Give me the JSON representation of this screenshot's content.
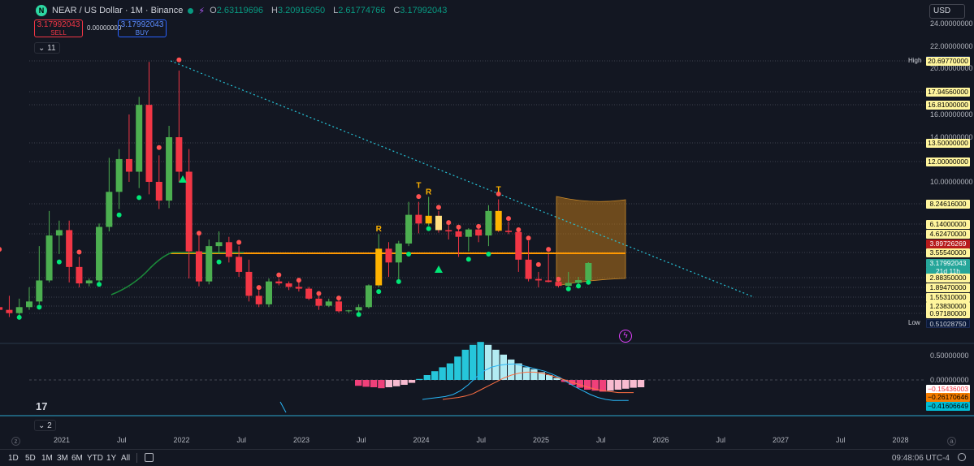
{
  "header": {
    "symbol_title": "NEAR / US Dollar · 1M · Binance",
    "logo_letter": "N",
    "ohlc": [
      {
        "key": "O",
        "value": "2.63119696"
      },
      {
        "key": "H",
        "value": "3.20916050"
      },
      {
        "key": "L",
        "value": "2.61774766"
      },
      {
        "key": "C",
        "value": "3.17992043"
      }
    ]
  },
  "trade": {
    "sell_price": "3.17992043",
    "sell_label": "SELL",
    "buy_price": "3.17992043",
    "buy_label": "BUY",
    "spread": "0.00000000"
  },
  "indicators_count": "11",
  "pane2_count": "2",
  "currency": "USD",
  "price_axis": {
    "labels": [
      {
        "value": 24,
        "text": "24.00000000"
      },
      {
        "value": 22,
        "text": "22.00000000"
      },
      {
        "value": 20,
        "text": "20.00000000"
      },
      {
        "value": 16,
        "text": "16.00000000"
      },
      {
        "value": 14,
        "text": "14.00000000"
      },
      {
        "value": 10,
        "text": "10.00000000"
      }
    ],
    "tags": [
      {
        "value": 20.69773581,
        "text": "20.69773581",
        "style": "navy",
        "side": "High"
      },
      {
        "value": 20.6977,
        "text": "20.69770000",
        "style": "yellow"
      },
      {
        "value": 17.9456,
        "text": "17.94560000",
        "style": "yellow"
      },
      {
        "value": 16.81,
        "text": "16.81000000",
        "style": "yellow"
      },
      {
        "value": 13.5,
        "text": "13.50000000",
        "style": "yellow"
      },
      {
        "value": 12,
        "text": "12.00000000",
        "style": "yellow"
      },
      {
        "value": 8.24616,
        "text": "8.24616000",
        "style": "yellow"
      },
      {
        "value": 6.14,
        "text": "6.14000000",
        "style": "yellow"
      },
      {
        "value": 4.6247,
        "text": "4.62470000",
        "style": "yellow"
      },
      {
        "value": 3.89726269,
        "text": "3.89726269",
        "style": "red"
      },
      {
        "value": 3.5554,
        "text": "3.55540000",
        "style": "yellow"
      },
      {
        "value": 3.17992043,
        "text": "3.17992043",
        "style": "teal"
      },
      {
        "value": 3.0,
        "text": "21d 11h",
        "style": "teal"
      },
      {
        "value": 2.8835,
        "text": "2.88350000",
        "style": "yellow"
      },
      {
        "value": 1.8947,
        "text": "1.89470000",
        "style": "yellow"
      },
      {
        "value": 1.5531,
        "text": "1.55310000",
        "style": "yellow"
      },
      {
        "value": 1.2383,
        "text": "1.23830000",
        "style": "yellow"
      },
      {
        "value": 0.9718,
        "text": "0.97180000",
        "style": "yellow"
      },
      {
        "value": 0.5102875,
        "text": "0.51028750",
        "style": "navy",
        "side": "Low"
      }
    ]
  },
  "macd_axis": {
    "labels": [
      {
        "value": 0.5,
        "text": "0.50000000"
      },
      {
        "value": 0.0,
        "text": "0.00000000"
      }
    ],
    "tags": [
      {
        "value": -0.15436003,
        "text": "−0.15436003",
        "style": "white"
      },
      {
        "value": -0.26170646,
        "text": "−0.26170646",
        "style": "orange"
      },
      {
        "value": -0.41606649,
        "text": "−0.41606649",
        "style": "tealx"
      }
    ]
  },
  "time_axis": [
    {
      "t": 2021.0,
      "text": "2021"
    },
    {
      "t": 2021.5,
      "text": "Jul"
    },
    {
      "t": 2022.0,
      "text": "2022"
    },
    {
      "t": 2022.5,
      "text": "Jul"
    },
    {
      "t": 2023.0,
      "text": "2023"
    },
    {
      "t": 2023.5,
      "text": "Jul"
    },
    {
      "t": 2024.0,
      "text": "2024"
    },
    {
      "t": 2024.5,
      "text": "Jul"
    },
    {
      "t": 2025.0,
      "text": "2025"
    },
    {
      "t": 2025.5,
      "text": "Jul"
    },
    {
      "t": 2026.0,
      "text": "2026"
    },
    {
      "t": 2026.5,
      "text": "Jul"
    },
    {
      "t": 2027.0,
      "text": "2027"
    },
    {
      "t": 2027.5,
      "text": "Jul"
    },
    {
      "t": 2028.0,
      "text": "2028"
    }
  ],
  "bottom": {
    "ranges": [
      "1D",
      "5D",
      "1M",
      "3M",
      "6M",
      "YTD",
      "1Y",
      "All"
    ],
    "clock": "09:48:06 UTC-4"
  },
  "colors": {
    "up": "#4caf50",
    "down": "#f23645",
    "accent": "#2962ff",
    "bg": "#131722"
  },
  "chart_data": {
    "type": "candlestick",
    "interval": "1M",
    "candles": [
      {
        "t": "2020-10",
        "o": 1.2,
        "h": 3.5,
        "l": 0.9,
        "c": 1.1
      },
      {
        "t": "2020-11",
        "o": 1.1,
        "h": 1.6,
        "l": 0.8,
        "c": 0.98
      },
      {
        "t": "2020-12",
        "o": 0.98,
        "h": 1.5,
        "l": 0.85,
        "c": 1.2
      },
      {
        "t": "2021-01",
        "o": 1.2,
        "h": 1.9,
        "l": 1.1,
        "c": 1.4
      },
      {
        "t": "2021-02",
        "o": 1.4,
        "h": 3.8,
        "l": 1.3,
        "c": 2.6
      },
      {
        "t": "2021-03",
        "o": 2.6,
        "h": 7.5,
        "l": 2.4,
        "c": 4.5
      },
      {
        "t": "2021-04",
        "o": 4.5,
        "h": 6.5,
        "l": 3.5,
        "c": 5.2
      },
      {
        "t": "2021-05",
        "o": 5.2,
        "h": 6.5,
        "l": 2.4,
        "c": 3.1
      },
      {
        "t": "2021-06",
        "o": 3.1,
        "h": 3.4,
        "l": 1.9,
        "c": 2.3
      },
      {
        "t": "2021-07",
        "o": 2.3,
        "h": 2.8,
        "l": 2.0,
        "c": 2.6
      },
      {
        "t": "2021-08",
        "o": 2.6,
        "h": 6.2,
        "l": 2.4,
        "c": 5.7
      },
      {
        "t": "2021-09",
        "o": 5.7,
        "h": 12.3,
        "l": 5.0,
        "c": 9.2
      },
      {
        "t": "2021-10",
        "o": 9.2,
        "h": 13.0,
        "l": 7.7,
        "c": 12.2
      },
      {
        "t": "2021-11",
        "o": 12.2,
        "h": 16.0,
        "l": 10.0,
        "c": 11.0
      },
      {
        "t": "2021-12",
        "o": 11.0,
        "h": 17.5,
        "l": 9.5,
        "c": 16.8
      },
      {
        "t": "2022-01",
        "o": 16.8,
        "h": 20.6,
        "l": 9.0,
        "c": 10.0
      },
      {
        "t": "2022-02",
        "o": 10.0,
        "h": 12.5,
        "l": 7.7,
        "c": 8.5
      },
      {
        "t": "2022-03",
        "o": 8.5,
        "h": 15.0,
        "l": 7.8,
        "c": 14.0
      },
      {
        "t": "2022-04",
        "o": 14.0,
        "h": 19.8,
        "l": 10.0,
        "c": 11.0
      },
      {
        "t": "2022-05",
        "o": 11.0,
        "h": 13.0,
        "l": 2.8,
        "c": 3.6
      },
      {
        "t": "2022-06",
        "o": 3.6,
        "h": 4.5,
        "l": 2.0,
        "c": 2.5
      },
      {
        "t": "2022-07",
        "o": 2.5,
        "h": 4.2,
        "l": 2.2,
        "c": 3.8
      },
      {
        "t": "2022-08",
        "o": 3.8,
        "h": 5.0,
        "l": 3.5,
        "c": 4.0
      },
      {
        "t": "2022-09",
        "o": 4.0,
        "h": 4.4,
        "l": 3.2,
        "c": 3.4
      },
      {
        "t": "2022-10",
        "o": 3.4,
        "h": 3.8,
        "l": 2.9,
        "c": 3.0
      },
      {
        "t": "2022-11",
        "o": 3.0,
        "h": 3.3,
        "l": 1.4,
        "c": 1.6
      },
      {
        "t": "2022-12",
        "o": 1.6,
        "h": 1.8,
        "l": 1.2,
        "c": 1.3
      },
      {
        "t": "2023-01",
        "o": 1.3,
        "h": 2.8,
        "l": 1.2,
        "c": 2.5
      },
      {
        "t": "2023-02",
        "o": 2.5,
        "h": 2.8,
        "l": 2.1,
        "c": 2.3
      },
      {
        "t": "2023-03",
        "o": 2.3,
        "h": 2.5,
        "l": 1.8,
        "c": 1.95
      },
      {
        "t": "2023-04",
        "o": 1.95,
        "h": 2.5,
        "l": 1.75,
        "c": 1.85
      },
      {
        "t": "2023-05",
        "o": 1.85,
        "h": 1.95,
        "l": 1.45,
        "c": 1.5
      },
      {
        "t": "2023-06",
        "o": 1.5,
        "h": 1.6,
        "l": 1.1,
        "c": 1.25
      },
      {
        "t": "2023-07",
        "o": 1.25,
        "h": 1.5,
        "l": 1.2,
        "c": 1.4
      },
      {
        "t": "2023-08",
        "o": 1.4,
        "h": 1.45,
        "l": 1.0,
        "c": 1.05
      },
      {
        "t": "2023-09",
        "o": 1.05,
        "h": 1.1,
        "l": 0.99,
        "c": 1.08
      },
      {
        "t": "2023-10",
        "o": 1.08,
        "h": 1.3,
        "l": 1.0,
        "c": 1.2
      },
      {
        "t": "2023-11",
        "o": 1.2,
        "h": 2.2,
        "l": 1.15,
        "c": 2.1
      },
      {
        "t": "2023-12",
        "o": 2.1,
        "h": 4.6,
        "l": 1.9,
        "c": 3.7
      },
      {
        "t": "2024-01",
        "o": 3.7,
        "h": 4.0,
        "l": 2.9,
        "c": 3.2
      },
      {
        "t": "2024-02",
        "o": 3.2,
        "h": 4.1,
        "l": 2.7,
        "c": 3.9
      },
      {
        "t": "2024-03",
        "o": 3.9,
        "h": 8.4,
        "l": 3.8,
        "c": 7.1
      },
      {
        "t": "2024-04",
        "o": 7.1,
        "h": 8.4,
        "l": 4.7,
        "c": 6.2
      },
      {
        "t": "2024-05",
        "o": 6.2,
        "h": 8.8,
        "l": 5.9,
        "c": 7.0
      },
      {
        "t": "2024-06",
        "o": 7.0,
        "h": 7.5,
        "l": 4.8,
        "c": 5.2
      },
      {
        "t": "2024-07",
        "o": 5.2,
        "h": 6.0,
        "l": 4.2,
        "c": 5.0
      },
      {
        "t": "2024-08",
        "o": 5.0,
        "h": 5.4,
        "l": 3.4,
        "c": 4.4
      },
      {
        "t": "2024-09",
        "o": 4.4,
        "h": 5.5,
        "l": 3.6,
        "c": 5.3
      },
      {
        "t": "2024-10",
        "o": 5.3,
        "h": 5.5,
        "l": 4.0,
        "c": 4.5
      },
      {
        "t": "2024-11",
        "o": 4.5,
        "h": 8.1,
        "l": 3.8,
        "c": 7.5
      },
      {
        "t": "2024-12",
        "o": 7.5,
        "h": 8.6,
        "l": 4.9,
        "c": 5.1
      },
      {
        "t": "2025-01",
        "o": 5.1,
        "h": 6.4,
        "l": 4.6,
        "c": 4.9
      },
      {
        "t": "2025-02",
        "o": 4.9,
        "h": 5.0,
        "l": 3.0,
        "c": 3.3
      },
      {
        "t": "2025-03",
        "o": 3.3,
        "h": 4.1,
        "l": 2.5,
        "c": 2.75
      },
      {
        "t": "2025-04",
        "o": 2.75,
        "h": 3.0,
        "l": 1.9,
        "c": 2.6
      },
      {
        "t": "2025-05",
        "o": 2.6,
        "h": 3.5,
        "l": 2.4,
        "c": 2.45
      },
      {
        "t": "2025-06",
        "o": 2.45,
        "h": 2.6,
        "l": 1.9,
        "c": 2.05
      },
      {
        "t": "2025-07",
        "o": 2.05,
        "h": 3.0,
        "l": 2.0,
        "c": 2.35
      },
      {
        "t": "2025-08",
        "o": 2.35,
        "h": 2.9,
        "l": 2.2,
        "c": 2.63
      },
      {
        "t": "2025-09",
        "o": 2.63,
        "h": 3.21,
        "l": 2.62,
        "c": 3.18
      }
    ],
    "annotations": [
      {
        "t": "2023-12",
        "text": "R",
        "value": 5.0
      },
      {
        "t": "2024-04",
        "text": "T",
        "value": 9.5
      },
      {
        "t": "2024-05",
        "text": "R",
        "value": 9.0
      },
      {
        "t": "2024-12",
        "text": "T",
        "value": 9.2
      }
    ],
    "macd": {
      "hist": [
        -0.12,
        -0.14,
        -0.15,
        -0.17,
        -0.15,
        -0.13,
        -0.1,
        -0.06,
        0.02,
        0.1,
        0.18,
        0.26,
        0.34,
        0.48,
        0.62,
        0.72,
        0.78,
        0.72,
        0.62,
        0.52,
        0.42,
        0.34,
        0.26,
        0.22,
        0.16,
        0.1,
        0.04,
        -0.04,
        -0.1,
        -0.16,
        -0.2,
        -0.22,
        -0.24,
        -0.22,
        -0.2,
        -0.18,
        -0.16,
        -0.15
      ],
      "macd": [
        -0.4,
        -0.38,
        -0.36,
        -0.34,
        -0.3,
        -0.22,
        -0.1,
        0.05,
        0.18,
        0.26,
        0.3,
        0.32,
        0.33,
        0.3,
        0.26,
        0.22,
        0.18,
        0.12,
        0.05,
        -0.05,
        -0.14,
        -0.22,
        -0.3,
        -0.36,
        -0.4,
        -0.42,
        -0.42,
        -0.42
      ],
      "signal": [
        -0.4,
        -0.38,
        -0.36,
        -0.33,
        -0.28,
        -0.2,
        -0.12,
        -0.04,
        0.04,
        0.1,
        0.14,
        0.16,
        0.16,
        0.14,
        0.1,
        0.05,
        0.0,
        -0.05,
        -0.1,
        -0.15,
        -0.19,
        -0.22,
        -0.24,
        -0.26,
        -0.26,
        -0.26
      ]
    }
  }
}
